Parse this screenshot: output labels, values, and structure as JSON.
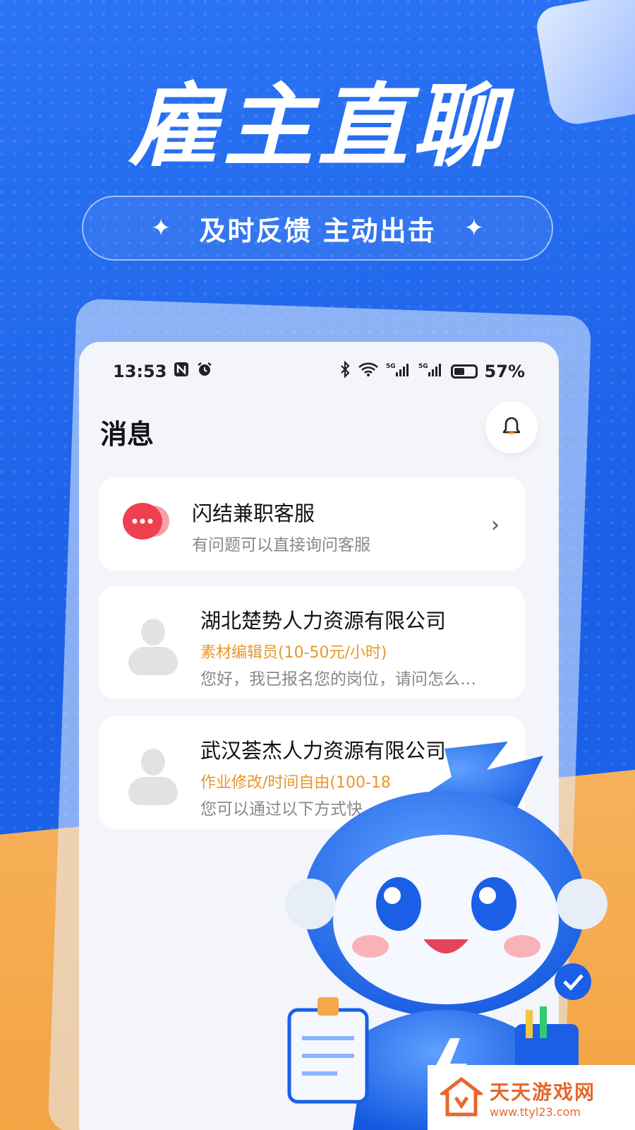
{
  "promo": {
    "headline": "雇主直聊",
    "slogan": "及时反馈 主动出击",
    "spark_left": "✦",
    "spark_right": "✦"
  },
  "status_bar": {
    "time": "13:53",
    "battery": "57%",
    "icons": [
      "nfc-icon",
      "alarm-icon",
      "bluetooth-icon",
      "wifi-icon",
      "signal-5g-icon",
      "signal-5g-icon",
      "battery-icon"
    ]
  },
  "header": {
    "title": "消息",
    "bell_icon": "bell-icon"
  },
  "support_item": {
    "title": "闪结兼职客服",
    "subtitle": "有问题可以直接询问客服"
  },
  "chats": [
    {
      "company": "湖北楚势人力资源有限公司",
      "job": "素材编辑员(10-50元/小时)",
      "message": "您好，我已报名您的岗位，请问怎么…"
    },
    {
      "company": "武汉荟杰人力资源有限公司",
      "job": "作业修改/时间自由(100-18",
      "message": "您可以通过以下方式快"
    }
  ],
  "watermark": {
    "name": "天天游戏网",
    "url": "www.ttyl23.com"
  },
  "colors": {
    "brand_blue": "#1d67ee",
    "accent_orange": "#e8962a",
    "floor_orange": "#f6b15a",
    "support_red": "#f0404f"
  }
}
